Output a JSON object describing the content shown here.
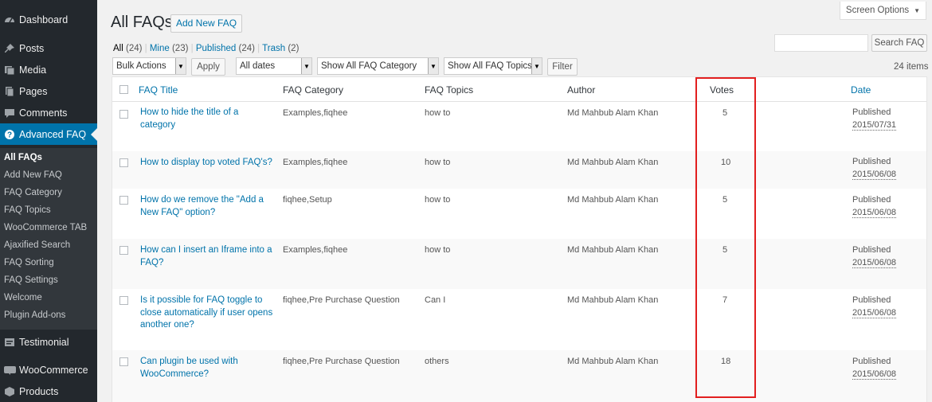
{
  "sidebar": {
    "items": [
      {
        "label": "Dashboard",
        "icon": "dashboard-icon"
      },
      {
        "label": "Posts",
        "icon": "pin-icon"
      },
      {
        "label": "Media",
        "icon": "media-icon"
      },
      {
        "label": "Pages",
        "icon": "pages-icon"
      },
      {
        "label": "Comments",
        "icon": "comments-icon"
      },
      {
        "label": "Advanced FAQ",
        "icon": "help-icon"
      },
      {
        "label": "Testimonial",
        "icon": "testimonial-icon"
      },
      {
        "label": "WooCommerce",
        "icon": "woocommerce-icon"
      },
      {
        "label": "Products",
        "icon": "products-icon"
      }
    ],
    "submenu": [
      "All FAQs",
      "Add New FAQ",
      "FAQ Category",
      "FAQ Topics",
      "WooCommerce TAB",
      "Ajaxified Search",
      "FAQ Sorting",
      "FAQ Settings",
      "Welcome",
      "Plugin Add-ons"
    ]
  },
  "header": {
    "title": "All FAQs",
    "add_new_label": "Add New FAQ",
    "screen_options_label": "Screen Options"
  },
  "views": [
    {
      "label": "All",
      "count": "(24)"
    },
    {
      "label": "Mine",
      "count": "(23)"
    },
    {
      "label": "Published",
      "count": "(24)"
    },
    {
      "label": "Trash",
      "count": "(2)"
    }
  ],
  "filters": {
    "bulk_actions": "Bulk Actions",
    "apply_label": "Apply",
    "dates": "All dates",
    "category": "Show All FAQ Category",
    "topics": "Show All FAQ Topics",
    "filter_label": "Filter",
    "search_label": "Search FAQ",
    "search_value": "",
    "items_count": "24 items"
  },
  "table": {
    "columns": [
      "FAQ Title",
      "FAQ Category",
      "FAQ Topics",
      "Author",
      "Votes",
      "Date"
    ],
    "rows": [
      {
        "title_lines": [
          "How to hide the title of a",
          "category"
        ],
        "category": "Examples,fiqhee",
        "topics": "how to",
        "author": "Md Mahbub Alam Khan",
        "votes": "5",
        "status": "Published",
        "date": "2015/07/31"
      },
      {
        "title_lines": [
          "How to display top voted FAQ's?"
        ],
        "category": "Examples,fiqhee",
        "topics": "how to",
        "author": "Md Mahbub Alam Khan",
        "votes": "10",
        "status": "Published",
        "date": "2015/06/08"
      },
      {
        "title_lines": [
          "How do we remove the \"Add a",
          "New FAQ\" option?"
        ],
        "category": "fiqhee,Setup",
        "topics": "how to",
        "author": "Md Mahbub Alam Khan",
        "votes": "5",
        "status": "Published",
        "date": "2015/06/08"
      },
      {
        "title_lines": [
          "How can I insert an Iframe into a",
          "FAQ?"
        ],
        "category": "Examples,fiqhee",
        "topics": "how to",
        "author": "Md Mahbub Alam Khan",
        "votes": "5",
        "status": "Published",
        "date": "2015/06/08"
      },
      {
        "title_lines": [
          "Is it possible for FAQ toggle to",
          "close automatically if user opens",
          "another one?"
        ],
        "category": "fiqhee,Pre Purchase Question",
        "topics": "Can I",
        "author": "Md Mahbub Alam Khan",
        "votes": "7",
        "status": "Published",
        "date": "2015/06/08"
      },
      {
        "title_lines": [
          "Can plugin be used with",
          "WooCommerce?"
        ],
        "category": "fiqhee,Pre Purchase Question",
        "topics": "others",
        "author": "Md Mahbub Alam Khan",
        "votes": "18",
        "status": "Published",
        "date": "2015/06/08"
      }
    ]
  },
  "colors": {
    "accent": "#0073aa",
    "sidebar_bg": "#23282d",
    "highlight": "#e21f1f"
  }
}
